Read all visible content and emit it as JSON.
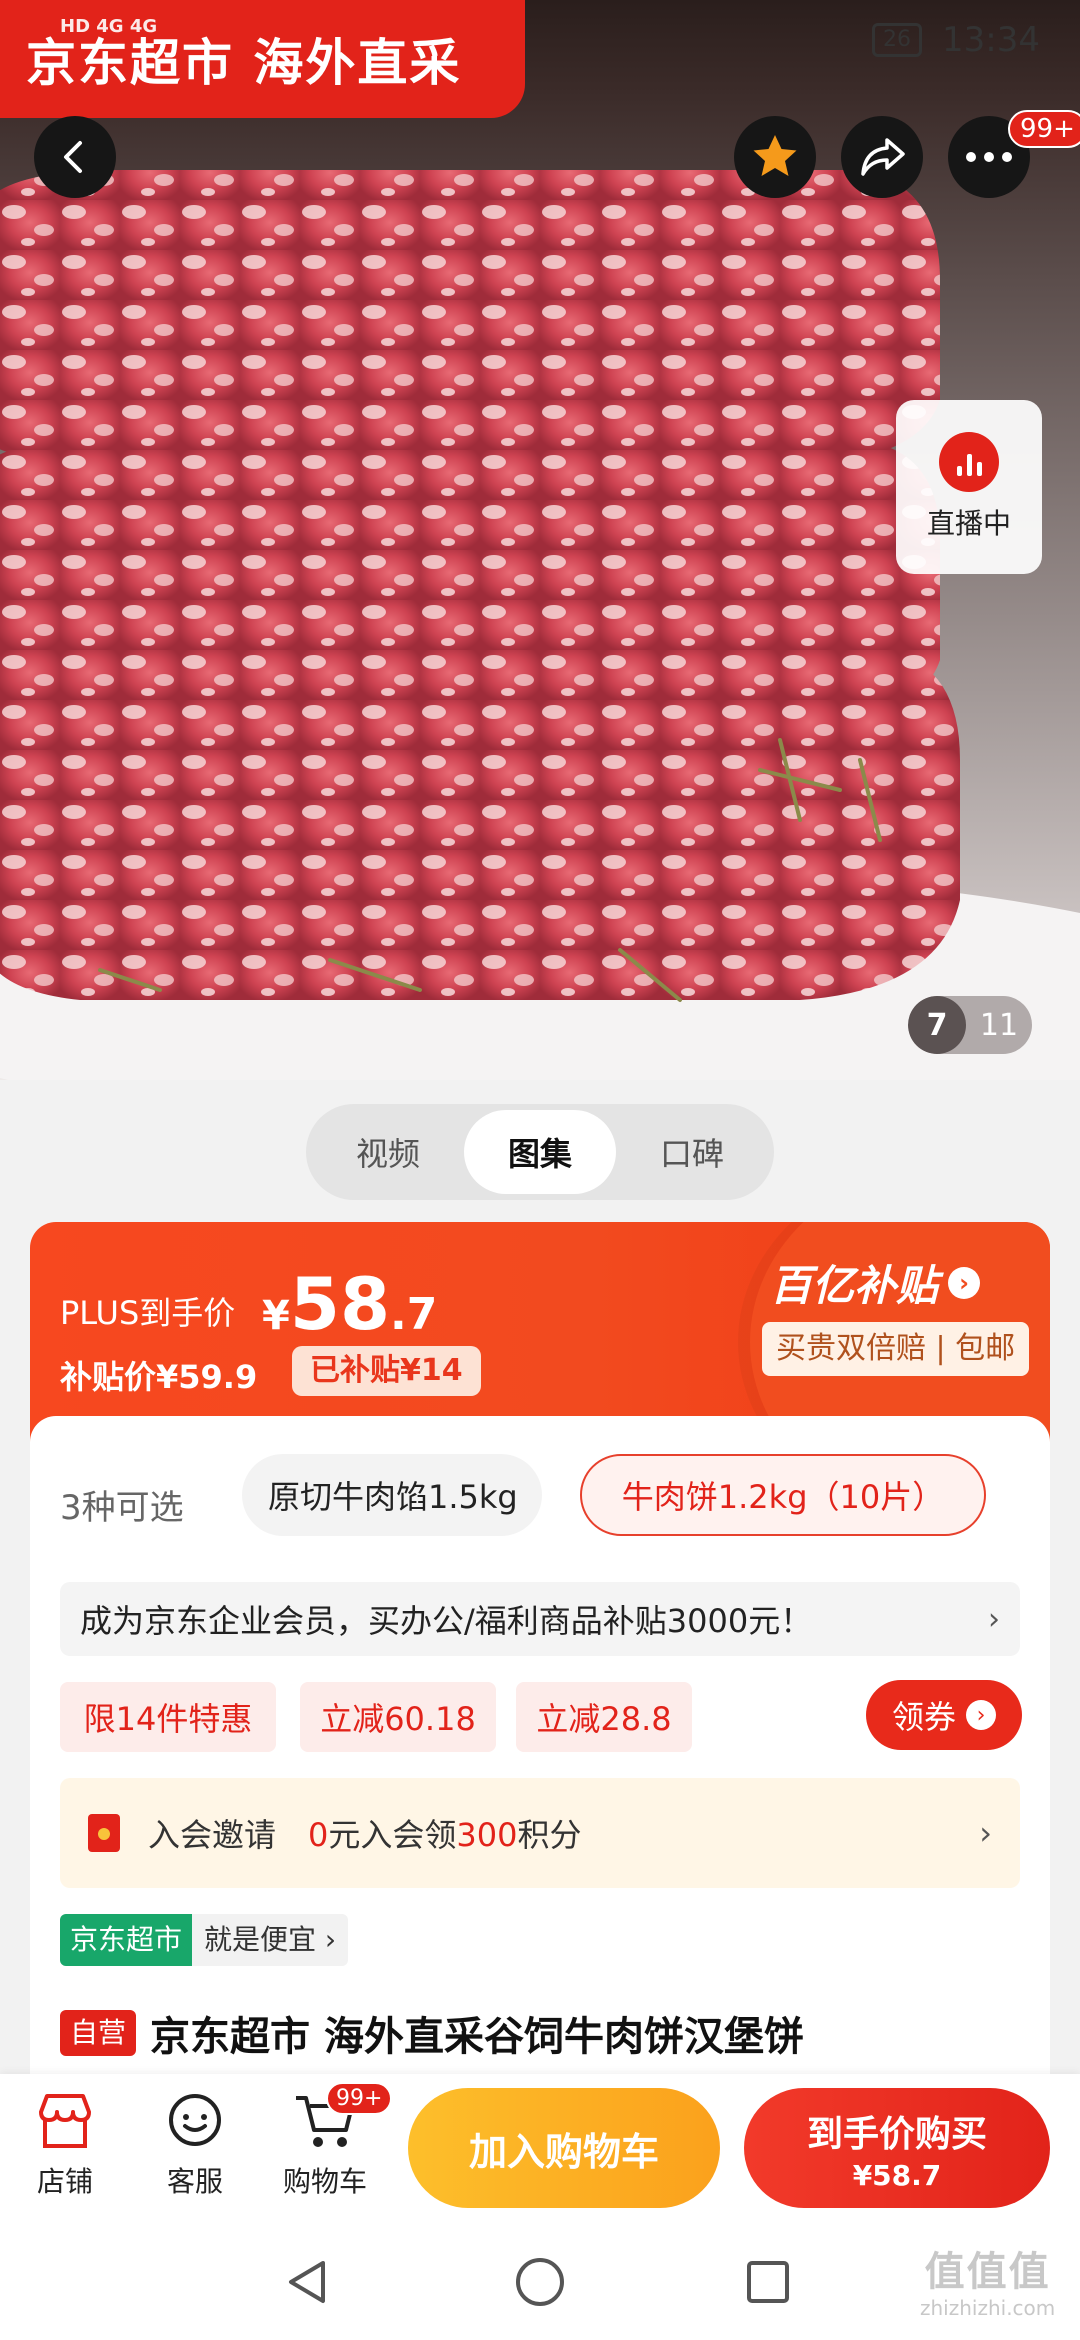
{
  "status": {
    "left": "HD 4G 4G",
    "battery": "26",
    "time": "13:34"
  },
  "brand_banner": "京东超市  海外直采",
  "hero": {
    "more_badge": "99+",
    "live_label": "直播中",
    "image_index": "7",
    "image_total": "11"
  },
  "media_tabs": [
    {
      "label": "视频"
    },
    {
      "label": "图集"
    },
    {
      "label": "口碑"
    }
  ],
  "price": {
    "plus_label": "PLUS到手价",
    "currency": "¥",
    "integer": "58",
    "decimal": ".7",
    "subsidy_price": "补贴价¥59.9",
    "subsidy_amount": "已补贴¥14",
    "billion_title": "百亿补贴",
    "billion_tag": "买贵双倍赔 | 包邮",
    "accent": "#f14d1f"
  },
  "variants": {
    "label": "3种可选",
    "items": [
      "原切牛肉馅1.5kg",
      "牛肉饼1.2kg（10片）"
    ]
  },
  "enterprise": {
    "text": "成为京东企业会员，买办公/福利商品补贴3000元！",
    "arrow": "›"
  },
  "promos": [
    "限14件特惠",
    "立减60.18",
    "立减28.8"
  ],
  "coupon_label": "领券",
  "invite": {
    "title": "入会邀请",
    "pre": "0",
    "mid": "元入会领",
    "points": "300",
    "post": "积分",
    "arrow": "›"
  },
  "jd_badge": {
    "green": "京东超市",
    "grey": "就是便宜 ›"
  },
  "product": {
    "tag": "自营",
    "title": "京东超市 海外直采谷饲牛肉饼汉堡饼"
  },
  "actions": {
    "shop": "店铺",
    "service": "客服",
    "cart": "购物车",
    "cart_badge": "99+",
    "add_cart": "加入购物车",
    "buy_line1": "到手价购买",
    "buy_line2": "¥58.7"
  },
  "watermark": {
    "big": "值值值",
    "small": "zhizhizhi.com"
  }
}
